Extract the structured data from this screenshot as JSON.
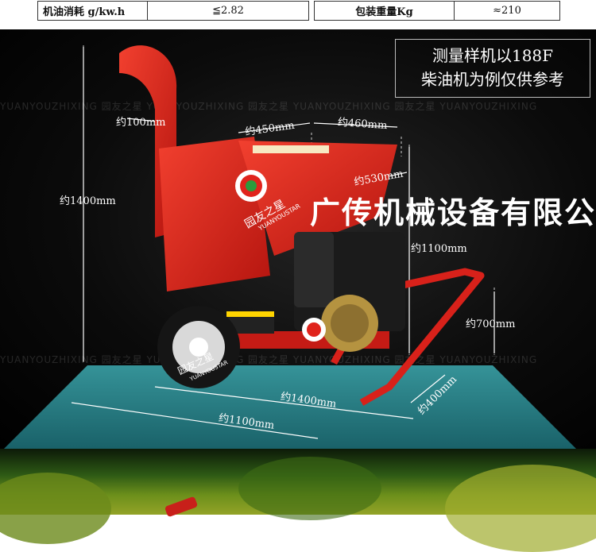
{
  "spec_table": {
    "row": [
      {
        "label": "机油消耗 g/kw.h",
        "value": "≦2.82"
      },
      {
        "label": "包装重量Kg",
        "value": "≈210"
      }
    ]
  },
  "notice": {
    "line1": "测量样机以188F",
    "line2": "柴油机为例仅供参考"
  },
  "company_name": "广传机械设备有限公司",
  "watermark_text": "YUANYOUZHIXING   园友之星   YUANYOUZHIXING   园友之星   YUANYOUZHIXING   园友之星   YUANYOUZHIXING",
  "brand": {
    "chinese": "园友之星",
    "english": "YUANYOUSTAR"
  },
  "dimensions": {
    "chute_width": "约100mm",
    "total_height": "约1400mm",
    "hopper_width_left": "约450mm",
    "hopper_width_right": "约460mm",
    "hopper_depth": "约530mm",
    "engine_height": "约1100mm",
    "handle_height": "约700mm",
    "handle_width": "约400mm",
    "total_length": "约1400mm",
    "wheel_track": "约1100mm"
  },
  "colors": {
    "machine_red": "#e0231c",
    "floor_teal": "#2c8f96",
    "background": "#0b0b0b"
  }
}
